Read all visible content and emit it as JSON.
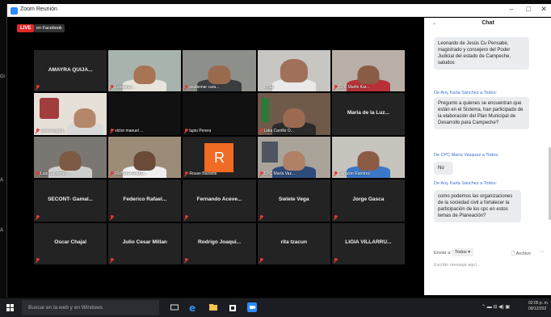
{
  "window": {
    "title": "Zoom Reunión",
    "controls": [
      "–",
      "□",
      "✕"
    ]
  },
  "video": {
    "live_badge": "LIVE",
    "stream_badge": "en Facebook"
  },
  "participants": [
    {
      "name": "AMAYRA QUIJA...",
      "label": "",
      "kind": "name"
    },
    {
      "name": "",
      "label": "Leonardo...",
      "kind": "video"
    },
    {
      "name": "",
      "label": "waldemar cara...",
      "kind": "video"
    },
    {
      "name": "",
      "label": "IJBEL",
      "kind": "video",
      "active": true
    },
    {
      "name": "",
      "label": "CPC Marlin Kar...",
      "kind": "video"
    },
    {
      "name": "",
      "label": "Silvia Miguel...",
      "kind": "video"
    },
    {
      "name": "",
      "label": "victor manuel ...",
      "kind": "blank"
    },
    {
      "name": "",
      "label": "lupio Perera",
      "kind": "blank"
    },
    {
      "name": "",
      "label": "Lidia Carrillo O...",
      "kind": "video"
    },
    {
      "name": "María de la Luz...",
      "label": "",
      "kind": "name"
    },
    {
      "name": "",
      "label": "Luis Guillermo ...",
      "kind": "video"
    },
    {
      "name": "",
      "label": "RUBEN ARNAB...",
      "kind": "video"
    },
    {
      "name": "",
      "label": "Rouse Bazante",
      "kind": "avatar",
      "avatar_letter": "R"
    },
    {
      "name": "",
      "label": "CPC María Vaz...",
      "kind": "video"
    },
    {
      "name": "",
      "label": "Corazón Ramírez",
      "kind": "video"
    },
    {
      "name": "SECONT- Gamal...",
      "label": "",
      "kind": "name"
    },
    {
      "name": "Federico Rafael...",
      "label": "",
      "kind": "name"
    },
    {
      "name": "Fernando Aceve...",
      "label": "",
      "kind": "name"
    },
    {
      "name": "Swiete Vega",
      "label": "",
      "kind": "name"
    },
    {
      "name": "Jorge Gasca",
      "label": "",
      "kind": "name"
    },
    {
      "name": "Oscar Chajal",
      "label": "",
      "kind": "name"
    },
    {
      "name": "Julio Cesar Millan",
      "label": "",
      "kind": "name"
    },
    {
      "name": "Rodrigo Joaqui...",
      "label": "",
      "kind": "name"
    },
    {
      "name": "rita tzacun",
      "label": "",
      "kind": "name"
    },
    {
      "name": "LIGIA VILLARRU...",
      "label": "",
      "kind": "name"
    }
  ],
  "chat": {
    "header": "Chat",
    "messages": [
      {
        "sender": "",
        "text": "Leonardo de Jesús Cu Pensabé, magistrado y consejero del Poder Judicial del estado de Campeche, saludos"
      },
      {
        "sender": "De Arq. Karla Sánchez a Todos:",
        "text": "Pregunto a quienes se encuentran que están en el Sistema, han participado de la elaboración del Plan Municipal de Desarrollo para Campeche?"
      },
      {
        "sender": "De CPC María Vazquez a Todos:",
        "text": "No"
      },
      {
        "sender": "De Arq. Karla Sánchez a Todos:",
        "text": "como podemos las organizaciones de la sociedad civil a fortalecer la participación de los cpc en estos temas de Planeación?"
      }
    ],
    "send_to_label": "Enviar a:",
    "send_to_value": "Todos ▾",
    "file_label": "Archivo",
    "more": "···",
    "compose_placeholder": "Escribir mensaje aquí..."
  },
  "taskbar": {
    "search_placeholder": "Buscar en la web y en Windows",
    "clock_time": "02:05 p. m.",
    "clock_date": "09/12/202"
  },
  "colors": {
    "live": "#e02828",
    "active_speaker": "#d8e13a",
    "chat_sender": "#3a6fd0",
    "zoom_blue": "#2d8cff"
  }
}
